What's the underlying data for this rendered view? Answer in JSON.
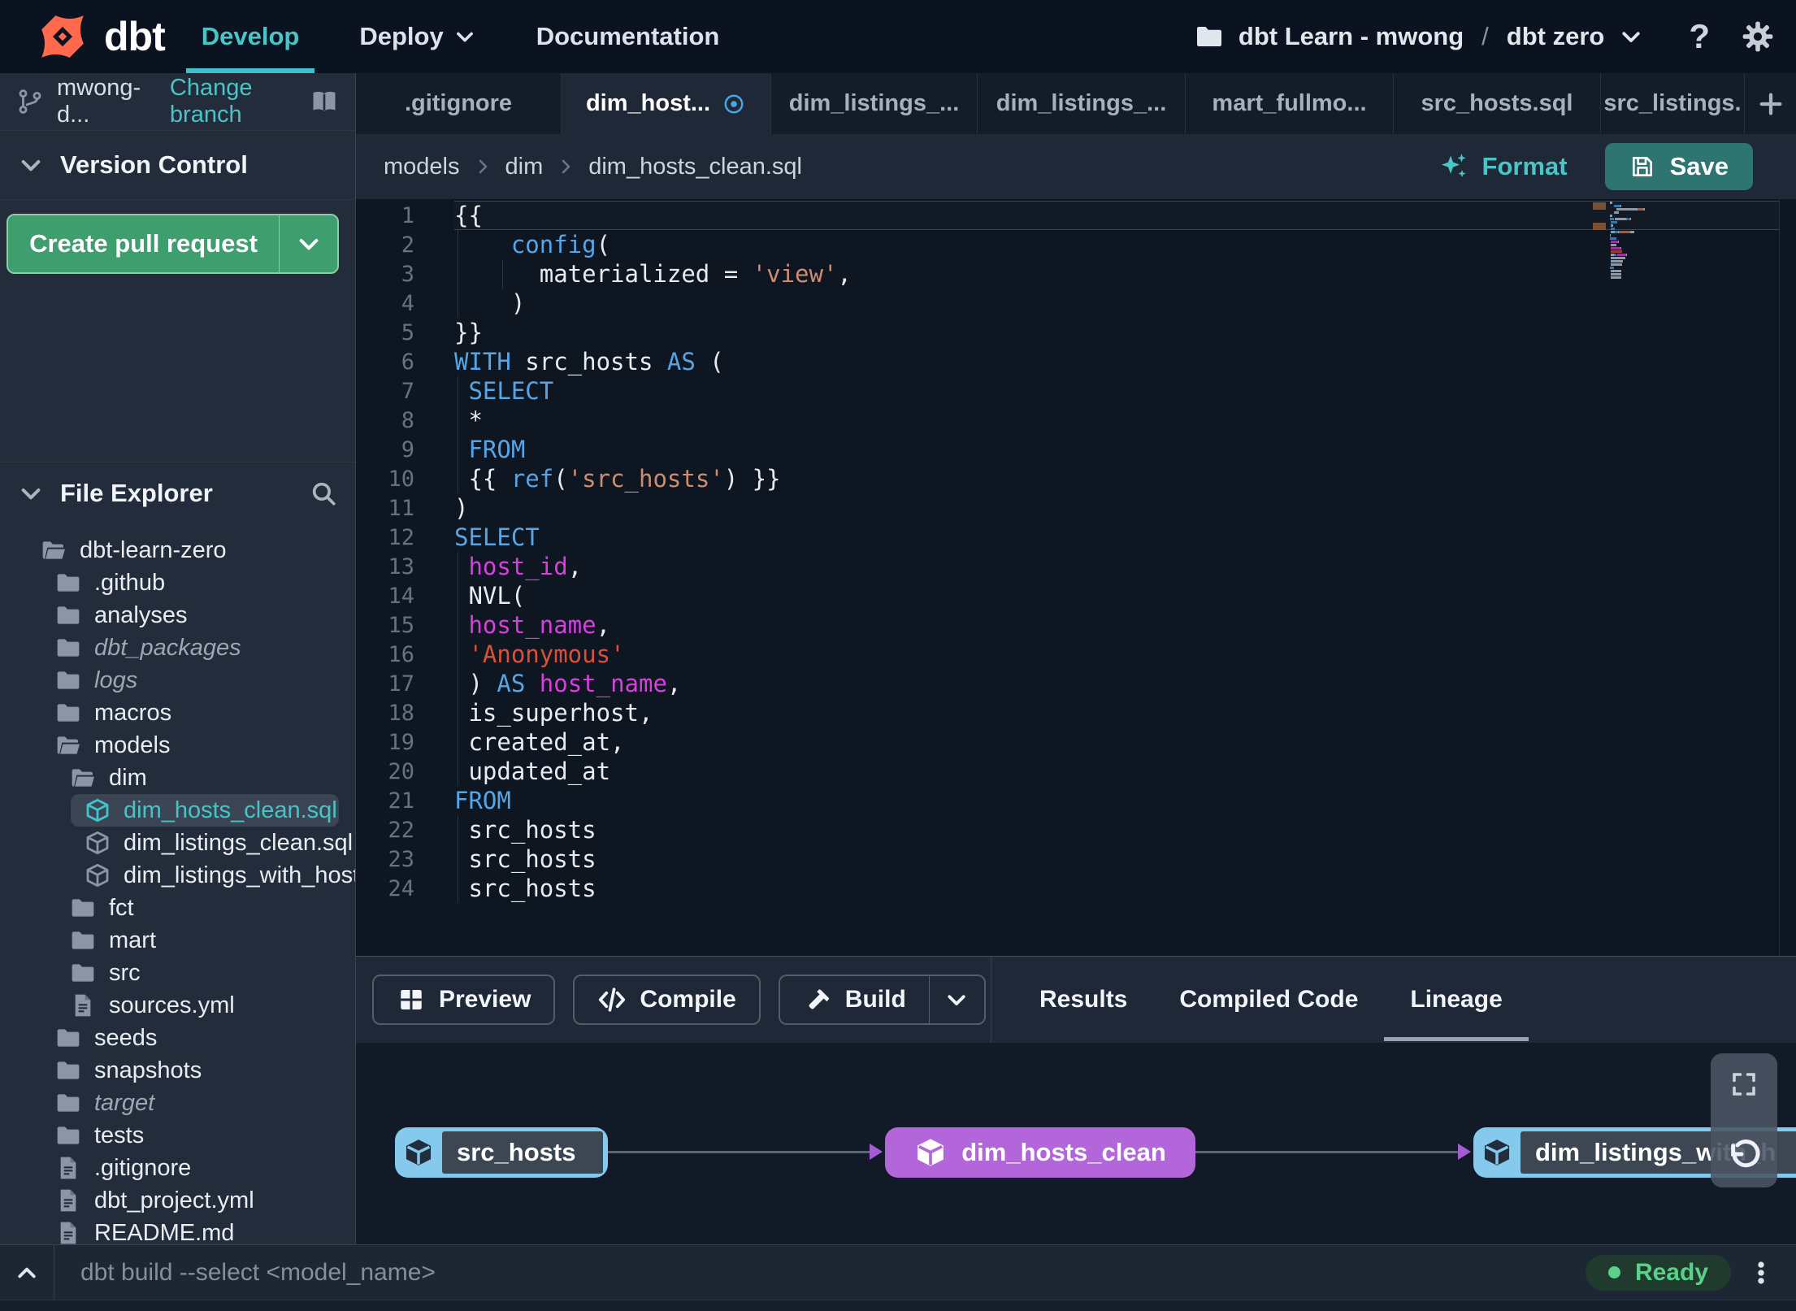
{
  "colors": {
    "accent_teal": "#3fc0c9",
    "logo_orange": "#ff6a4d",
    "green_button": "#3f9e6e",
    "save_teal": "#2e7470",
    "node_blue": "#85c9ec",
    "node_purple": "#b266d9",
    "edge_arrow_purple": "#a55bd6",
    "ready_green": "#58d189",
    "modified_blue": "#4aa6e8",
    "code_keyword": "#56a5e6",
    "code_identifier": "#d83fdd",
    "code_string": "#cd8d71",
    "code_string_red": "#de4f37"
  },
  "navbar": {
    "logo_text": "dbt",
    "nav": [
      {
        "label": "Develop",
        "active": true
      },
      {
        "label": "Deploy",
        "chevron": true
      },
      {
        "label": "Documentation"
      }
    ],
    "project": {
      "account": "dbt Learn - mwong",
      "separator": "/",
      "name": "dbt zero"
    }
  },
  "sidebar": {
    "branch": {
      "name": "mwong-d...",
      "change_link": "Change branch"
    },
    "version_control": {
      "title": "Version Control",
      "create_pr_label": "Create pull request"
    },
    "file_explorer": {
      "title": "File Explorer",
      "tree": [
        {
          "label": "dbt-learn-zero",
          "icon": "folder-open",
          "indent": 0
        },
        {
          "label": ".github",
          "icon": "folder",
          "indent": 1
        },
        {
          "label": "analyses",
          "icon": "folder",
          "indent": 1
        },
        {
          "label": "dbt_packages",
          "icon": "folder",
          "indent": 1,
          "italic": true
        },
        {
          "label": "logs",
          "icon": "folder",
          "indent": 1,
          "italic": true
        },
        {
          "label": "macros",
          "icon": "folder",
          "indent": 1
        },
        {
          "label": "models",
          "icon": "folder-open",
          "indent": 1
        },
        {
          "label": "dim",
          "icon": "folder-open",
          "indent": 2
        },
        {
          "label": "dim_hosts_clean.sql",
          "icon": "model-cube",
          "indent": 3,
          "selected": true,
          "modified": true
        },
        {
          "label": "dim_listings_clean.sql",
          "icon": "model-cube",
          "indent": 3
        },
        {
          "label": "dim_listings_with_hosts...",
          "icon": "model-cube",
          "indent": 3
        },
        {
          "label": "fct",
          "icon": "folder",
          "indent": 2
        },
        {
          "label": "mart",
          "icon": "folder",
          "indent": 2
        },
        {
          "label": "src",
          "icon": "folder",
          "indent": 2
        },
        {
          "label": "sources.yml",
          "icon": "file",
          "indent": 2
        },
        {
          "label": "seeds",
          "icon": "folder",
          "indent": 1
        },
        {
          "label": "snapshots",
          "icon": "folder",
          "indent": 1
        },
        {
          "label": "target",
          "icon": "folder",
          "indent": 1,
          "italic": true
        },
        {
          "label": "tests",
          "icon": "folder",
          "indent": 1
        },
        {
          "label": ".gitignore",
          "icon": "file",
          "indent": 1
        },
        {
          "label": "dbt_project.yml",
          "icon": "file",
          "indent": 1
        },
        {
          "label": "README.md",
          "icon": "file",
          "indent": 1
        }
      ]
    }
  },
  "tabs": [
    {
      "label": ".gitignore"
    },
    {
      "label": "dim_host...",
      "active": true,
      "modified": true
    },
    {
      "label": "dim_listings_..."
    },
    {
      "label": "dim_listings_..."
    },
    {
      "label": "mart_fullmo..."
    },
    {
      "label": "src_hosts.sql"
    },
    {
      "label": "src_listings."
    }
  ],
  "editor_header": {
    "breadcrumb": [
      "models",
      "dim",
      "dim_hosts_clean.sql"
    ],
    "format_label": "Format",
    "save_label": "Save"
  },
  "editor": {
    "lines": [
      {
        "n": "1",
        "active": true,
        "seg": [
          [
            "pl",
            "{{"
          ]
        ]
      },
      {
        "n": "2",
        "seg": [
          [
            "pl",
            "    "
          ],
          [
            "kw",
            "config"
          ],
          [
            "pl",
            "("
          ]
        ]
      },
      {
        "n": "3",
        "seg": [
          [
            "pl",
            "      materialized = "
          ],
          [
            "str",
            "'view'"
          ],
          [
            "pl",
            ","
          ]
        ]
      },
      {
        "n": "4",
        "seg": [
          [
            "pl",
            "    )"
          ]
        ]
      },
      {
        "n": "5",
        "seg": [
          [
            "pl",
            "}}"
          ]
        ]
      },
      {
        "n": "6",
        "seg": [
          [
            "kw",
            "WITH"
          ],
          [
            "pl",
            " src_hosts "
          ],
          [
            "kw",
            "AS"
          ],
          [
            "pl",
            " ("
          ]
        ]
      },
      {
        "n": "7",
        "seg": [
          [
            "pl",
            " "
          ],
          [
            "kw",
            "SELECT"
          ]
        ]
      },
      {
        "n": "8",
        "seg": [
          [
            "pl",
            " *"
          ]
        ]
      },
      {
        "n": "9",
        "seg": [
          [
            "pl",
            " "
          ],
          [
            "kw",
            "FROM"
          ]
        ]
      },
      {
        "n": "10",
        "seg": [
          [
            "pl",
            " {{ "
          ],
          [
            "kw",
            "ref"
          ],
          [
            "pl",
            "("
          ],
          [
            "str",
            "'src_hosts'"
          ],
          [
            "pl",
            ") }}"
          ]
        ]
      },
      {
        "n": "11",
        "seg": [
          [
            "pl",
            ")"
          ]
        ]
      },
      {
        "n": "12",
        "seg": [
          [
            "kw",
            "SELECT"
          ]
        ]
      },
      {
        "n": "13",
        "seg": [
          [
            "pl",
            " "
          ],
          [
            "id",
            "host_id"
          ],
          [
            "pl",
            ","
          ]
        ]
      },
      {
        "n": "14",
        "seg": [
          [
            "pl",
            " NVL("
          ]
        ]
      },
      {
        "n": "15",
        "seg": [
          [
            "pl",
            " "
          ],
          [
            "id",
            "host_name"
          ],
          [
            "pl",
            ","
          ]
        ]
      },
      {
        "n": "16",
        "seg": [
          [
            "pl",
            " "
          ],
          [
            "strr",
            "'Anonymous'"
          ]
        ]
      },
      {
        "n": "17",
        "seg": [
          [
            "pl",
            " ) "
          ],
          [
            "kw",
            "AS"
          ],
          [
            "pl",
            " "
          ],
          [
            "id",
            "host_name"
          ],
          [
            "pl",
            ","
          ]
        ]
      },
      {
        "n": "18",
        "seg": [
          [
            "pl",
            " is_superhost,"
          ]
        ]
      },
      {
        "n": "19",
        "seg": [
          [
            "pl",
            " created_at,"
          ]
        ]
      },
      {
        "n": "20",
        "seg": [
          [
            "pl",
            " updated_at"
          ]
        ]
      },
      {
        "n": "21",
        "seg": [
          [
            "kw",
            "FROM"
          ]
        ]
      },
      {
        "n": "22",
        "seg": [
          [
            "pl",
            " src_hosts"
          ]
        ]
      },
      {
        "n": "23",
        "seg": [
          [
            "pl",
            " src_hosts"
          ]
        ]
      },
      {
        "n": "24",
        "seg": [
          [
            "pl",
            " src_hosts"
          ]
        ]
      }
    ]
  },
  "bottom_panel": {
    "actions": [
      {
        "label": "Preview",
        "icon": "grid"
      },
      {
        "label": "Compile",
        "icon": "code"
      },
      {
        "label": "Build",
        "icon": "hammer",
        "split": true
      }
    ],
    "tabs": [
      {
        "label": "Results"
      },
      {
        "label": "Compiled Code"
      },
      {
        "label": "Lineage",
        "active": true
      }
    ]
  },
  "lineage": {
    "nodes": [
      {
        "label": "src_hosts",
        "variant": "blue"
      },
      {
        "label": "dim_hosts_clean",
        "variant": "purple"
      },
      {
        "label": "dim_listings_with_h",
        "variant": "blue"
      }
    ]
  },
  "command_bar": {
    "placeholder": "dbt build --select <model_name>",
    "status": "Ready"
  }
}
